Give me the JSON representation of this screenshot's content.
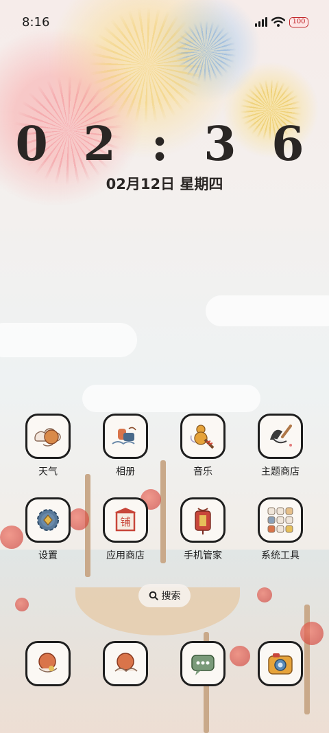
{
  "status_bar": {
    "time": "8:16",
    "battery": "100"
  },
  "clock": {
    "time": "0 2 : 3 6",
    "date": "02月12日 星期四"
  },
  "apps": [
    {
      "label": "天气",
      "icon": "weather-icon"
    },
    {
      "label": "相册",
      "icon": "gallery-icon"
    },
    {
      "label": "音乐",
      "icon": "music-icon"
    },
    {
      "label": "主题商店",
      "icon": "theme-store-icon"
    },
    {
      "label": "设置",
      "icon": "settings-icon"
    },
    {
      "label": "应用商店",
      "icon": "app-store-icon"
    },
    {
      "label": "手机管家",
      "icon": "phone-manager-icon"
    },
    {
      "label": "系统工具",
      "icon": "system-tools-icon"
    }
  ],
  "app_store_sign": "铺",
  "search": {
    "label": "搜索"
  },
  "dock": [
    {
      "icon": "phone-icon"
    },
    {
      "icon": "browser-icon"
    },
    {
      "icon": "messages-icon"
    },
    {
      "icon": "camera-icon"
    }
  ],
  "colors": {
    "accent_red": "#c2282c",
    "ink": "#1e1e1e",
    "icon_bg": "#fbf8f4"
  }
}
